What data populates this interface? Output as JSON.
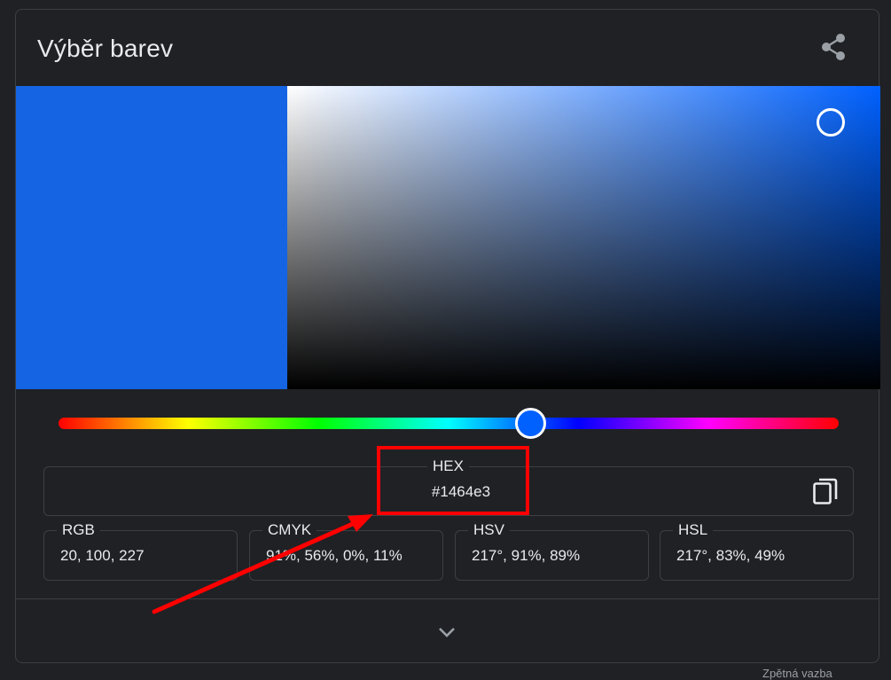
{
  "widget": {
    "title": "Výběr barev",
    "selected_color": "#1464e3",
    "hue_color": "#0061ff",
    "hue_degrees": 217,
    "saturation_fraction": 0.91,
    "value_fraction": 0.89
  },
  "hex": {
    "label": "HEX",
    "value": "#1464e3"
  },
  "formats": [
    {
      "label": "RGB",
      "value": "20, 100, 227"
    },
    {
      "label": "CMYK",
      "value": "91%, 56%, 0%, 11%"
    },
    {
      "label": "HSV",
      "value": "217°, 91%, 89%"
    },
    {
      "label": "HSL",
      "value": "217°, 83%, 49%"
    }
  ],
  "icons": {
    "share": "share-icon",
    "copy": "copy-icon",
    "expand": "chevron-down-icon"
  },
  "annotation_color": "#ff0000",
  "footer": {
    "text": "Zpětná vazba"
  }
}
